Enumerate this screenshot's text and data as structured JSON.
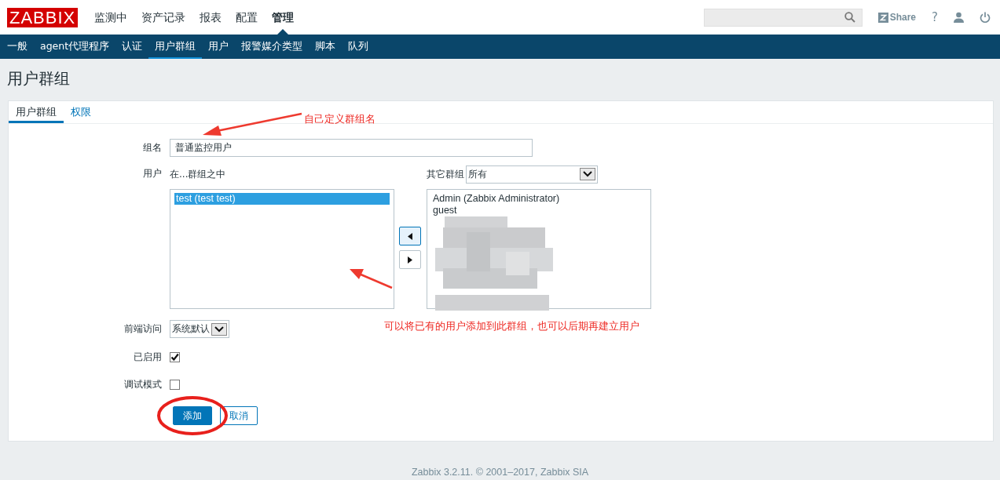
{
  "header": {
    "logo": "ZABBIX",
    "menu": [
      {
        "label": "监测中",
        "selected": false
      },
      {
        "label": "资产记录",
        "selected": false
      },
      {
        "label": "报表",
        "selected": false
      },
      {
        "label": "配置",
        "selected": false
      },
      {
        "label": "管理",
        "selected": true
      }
    ],
    "share": "Share",
    "help": "?"
  },
  "submenu": [
    {
      "label": "一般",
      "selected": false
    },
    {
      "label": "agent代理程序",
      "selected": false
    },
    {
      "label": "认证",
      "selected": false
    },
    {
      "label": "用户群组",
      "selected": true
    },
    {
      "label": "用户",
      "selected": false
    },
    {
      "label": "报警媒介类型",
      "selected": false
    },
    {
      "label": "脚本",
      "selected": false
    },
    {
      "label": "队列",
      "selected": false
    }
  ],
  "page_title": "用户群组",
  "tabs": [
    {
      "label": "用户群组",
      "selected": true
    },
    {
      "label": "权限",
      "selected": false
    }
  ],
  "form": {
    "group_name_label": "组名",
    "group_name": "普通监控用户",
    "users_label": "用户",
    "in_groups_label": "在...群组之中",
    "other_groups_label": "其它群组",
    "other_groups_value": "所有",
    "members": [
      {
        "label": "test (test test)",
        "selected": true
      }
    ],
    "others": [
      {
        "label": "Admin (Zabbix Administrator)",
        "selected": false
      },
      {
        "label": "guest",
        "selected": false
      }
    ],
    "frontend_label": "前端访问",
    "frontend_value": "系统默认",
    "enabled_label": "已启用",
    "enabled": true,
    "debug_label": "调试模式",
    "debug": false,
    "add": "添加",
    "cancel": "取消"
  },
  "annotations": [
    "自己定义群组名",
    "可以将已有的用户添加到此群组，也可以后期再建立用户"
  ],
  "footer": "Zabbix 3.2.11. © 2001–2017, Zabbix SIA"
}
